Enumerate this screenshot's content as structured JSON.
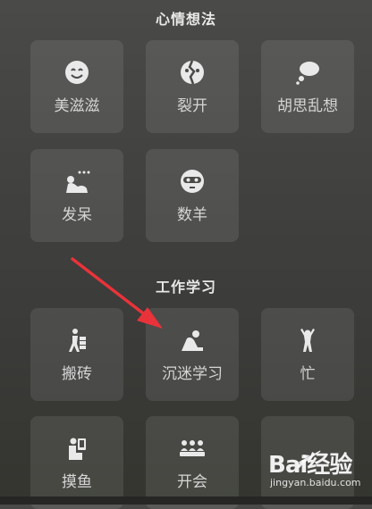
{
  "sections": [
    {
      "title": "心情想法",
      "items": [
        {
          "label": "美滋滋",
          "icon": "smile-icon"
        },
        {
          "label": "裂开",
          "icon": "cracked-face-icon"
        },
        {
          "label": "胡思乱想",
          "icon": "thought-bubble-icon"
        },
        {
          "label": "发呆",
          "icon": "daydream-icon"
        },
        {
          "label": "数羊",
          "icon": "sleep-mask-icon"
        }
      ]
    },
    {
      "title": "工作学习",
      "items": [
        {
          "label": "搬砖",
          "icon": "carry-bricks-icon"
        },
        {
          "label": "沉迷学习",
          "icon": "studying-icon"
        },
        {
          "label": "忙",
          "icon": "busy-icon"
        },
        {
          "label": "摸鱼",
          "icon": "slacking-icon"
        },
        {
          "label": "开会",
          "icon": "meeting-icon"
        },
        {
          "label": "",
          "icon": "airplane-icon"
        }
      ]
    }
  ],
  "watermark": {
    "logo": "Bai经验",
    "url": "jingyan.baidu.com"
  },
  "colors": {
    "arrow": "#e8333a",
    "tile": "#5a5a58",
    "label": "#d5d5d5"
  }
}
